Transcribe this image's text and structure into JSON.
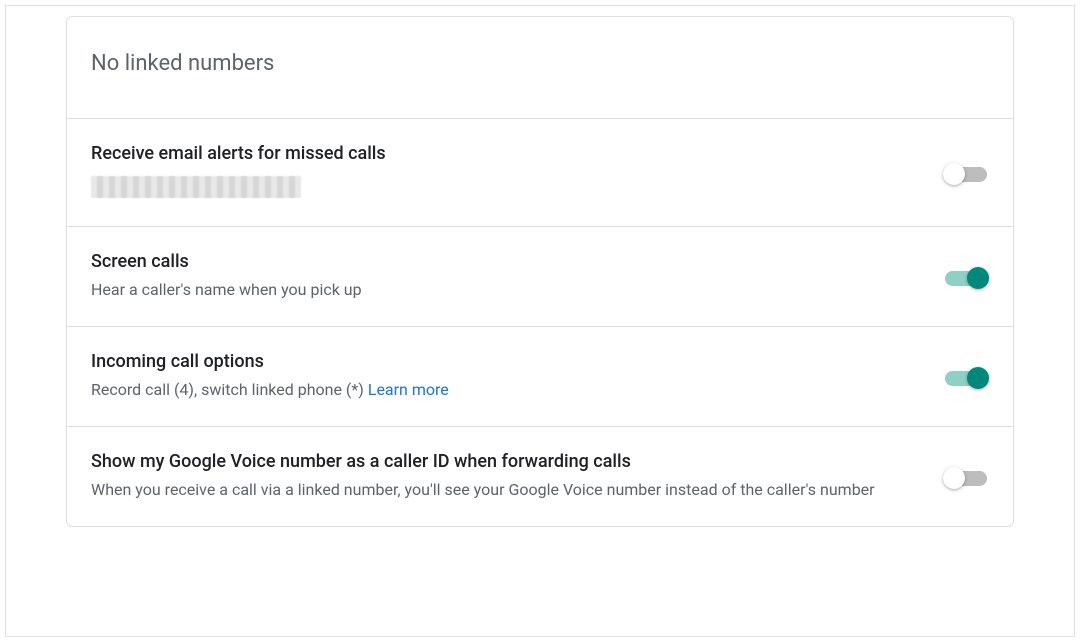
{
  "header": {
    "title": "No linked numbers"
  },
  "settings": {
    "email_alerts": {
      "title": "Receive email alerts for missed calls",
      "state": "off"
    },
    "screen_calls": {
      "title": "Screen calls",
      "desc": "Hear a caller's name when you pick up",
      "state": "on"
    },
    "incoming_options": {
      "title": "Incoming call options",
      "desc_prefix": "Record call (4), switch linked phone (*) ",
      "link_label": "Learn more",
      "state": "on"
    },
    "caller_id": {
      "title": "Show my Google Voice number as a caller ID when forwarding calls",
      "desc": "When you receive a call via a linked number, you'll see your Google Voice number instead of the caller's number",
      "state": "off"
    }
  }
}
